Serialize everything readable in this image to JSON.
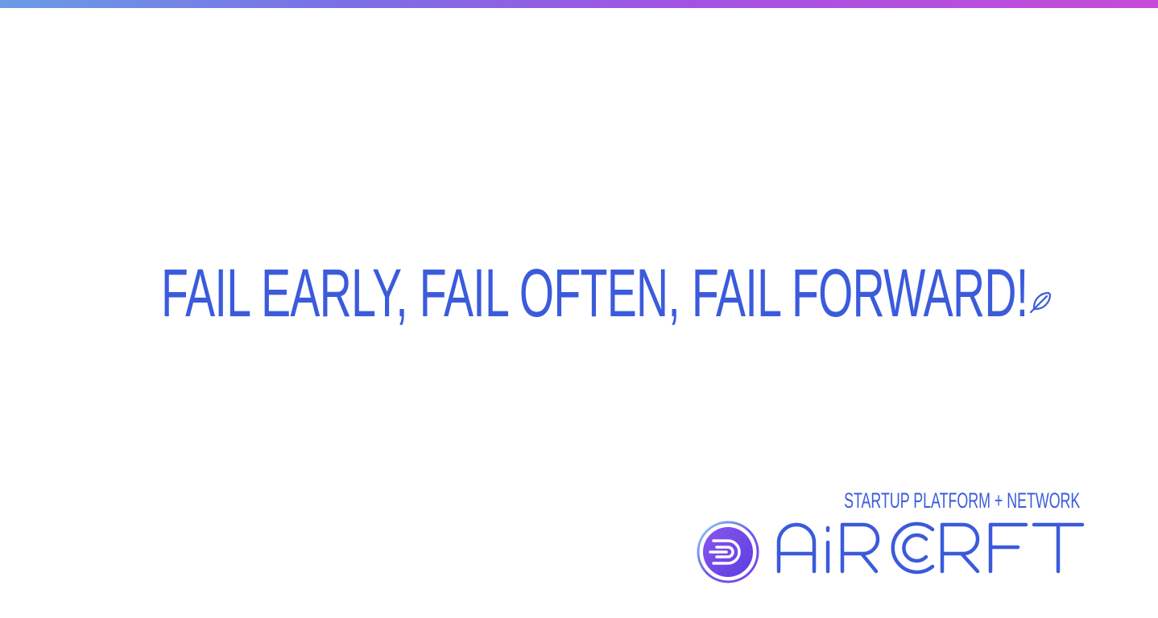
{
  "slide": {
    "headline": "FAIL EARLY, FAIL OFTEN, FAIL FORWARD!",
    "headline_icon": "feather-icon"
  },
  "brand": {
    "tagline": "STARTUP PLATFORM + NETWORK",
    "wordmark": "AIRCRFT",
    "logo_icon": "aircrft-logo-mark"
  },
  "colors": {
    "text_blue": "#3b5bdb",
    "bar_start": "#6a9be6",
    "bar_mid": "#a352e3",
    "bar_end": "#c64bd8",
    "logo_cyan": "#6ad0f0",
    "logo_purple": "#7b3fe0"
  }
}
